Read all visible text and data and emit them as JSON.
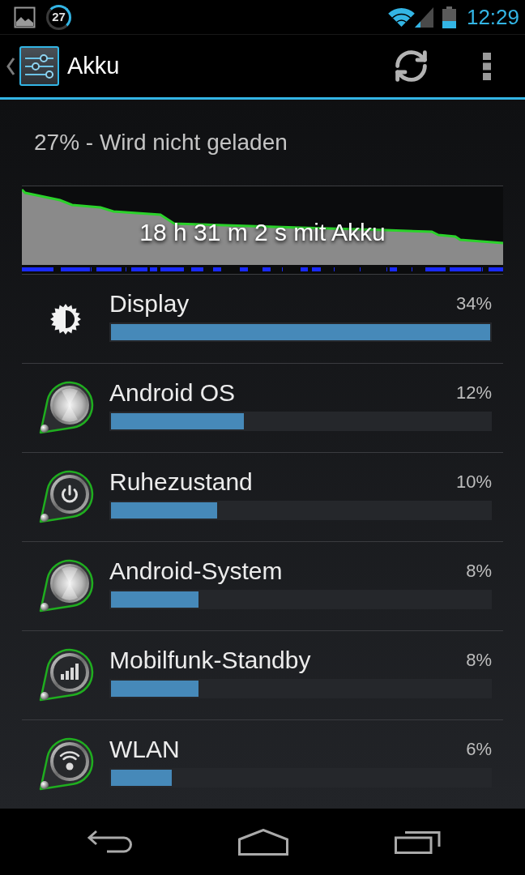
{
  "status_bar": {
    "notification_count": "27",
    "time": "12:29"
  },
  "action_bar": {
    "title": "Akku"
  },
  "summary": "27% - Wird nicht geladen",
  "graph": {
    "caption": "18 h 31 m 2 s mit Akku"
  },
  "usage": [
    {
      "kind": "screen",
      "name": "Display",
      "percent": "34%",
      "level": 1
    },
    {
      "kind": "app",
      "name": "Android OS",
      "percent": "12%",
      "level": 0.35
    },
    {
      "kind": "idle",
      "name": "Ruhezustand",
      "percent": "10%",
      "level": 0.28
    },
    {
      "kind": "app",
      "name": "Android-System",
      "percent": "8%",
      "level": 0.23
    },
    {
      "kind": "cell",
      "name": "Mobilfunk-Standby",
      "percent": "8%",
      "level": 0.23
    },
    {
      "kind": "wifi",
      "name": "WLAN",
      "percent": "6%",
      "level": 0.16
    }
  ]
}
